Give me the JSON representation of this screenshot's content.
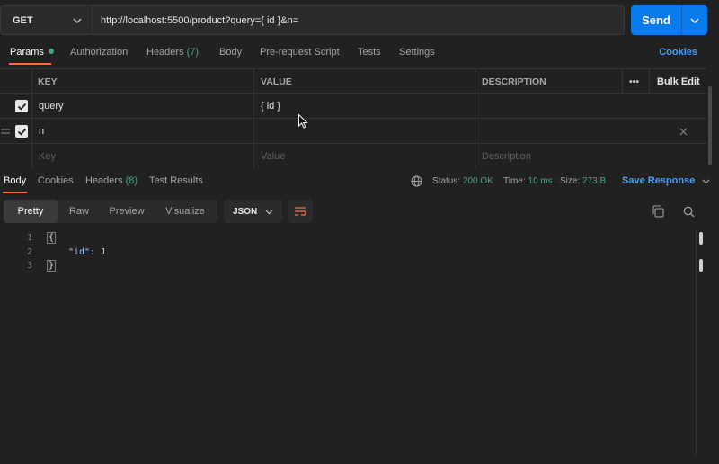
{
  "request": {
    "method": "GET",
    "url": "http://localhost:5500/product?query={ id }&n=",
    "send_label": "Send"
  },
  "request_tabs": [
    {
      "label": "Params",
      "active": true,
      "dot": true
    },
    {
      "label": "Authorization"
    },
    {
      "label": "Headers",
      "count": "(7)"
    },
    {
      "label": "Body"
    },
    {
      "label": "Pre-request Script"
    },
    {
      "label": "Tests"
    },
    {
      "label": "Settings"
    }
  ],
  "cookies_label": "Cookies",
  "params": {
    "headers": {
      "key": "KEY",
      "value": "VALUE",
      "description": "DESCRIPTION",
      "more": "•••",
      "bulk_edit": "Bulk Edit"
    },
    "rows": [
      {
        "key": "query",
        "value": "{ id }",
        "checked": true
      },
      {
        "key": "n",
        "value": "",
        "checked": true
      }
    ],
    "placeholders": {
      "key": "Key",
      "value": "Value",
      "description": "Description"
    }
  },
  "response_tabs": [
    {
      "label": "Body",
      "active": true
    },
    {
      "label": "Cookies"
    },
    {
      "label": "Headers",
      "count": "(8)"
    },
    {
      "label": "Test Results"
    }
  ],
  "response_meta": {
    "status_label": "Status:",
    "status_value": "200 OK",
    "time_label": "Time:",
    "time_value": "10 ms",
    "size_label": "Size:",
    "size_value": "273 B",
    "save_label": "Save Response"
  },
  "view_modes": [
    "Pretty",
    "Raw",
    "Preview",
    "Visualize"
  ],
  "format_select": "JSON",
  "code": {
    "line_numbers": [
      "1",
      "2",
      "3"
    ],
    "open": "{",
    "key": "\"id\"",
    "sep": ": ",
    "value": "1",
    "close": "}"
  },
  "colors": {
    "accent": "#ff6c37",
    "send": "#097bed",
    "link": "#4f9cf1",
    "success": "#49a37f"
  }
}
